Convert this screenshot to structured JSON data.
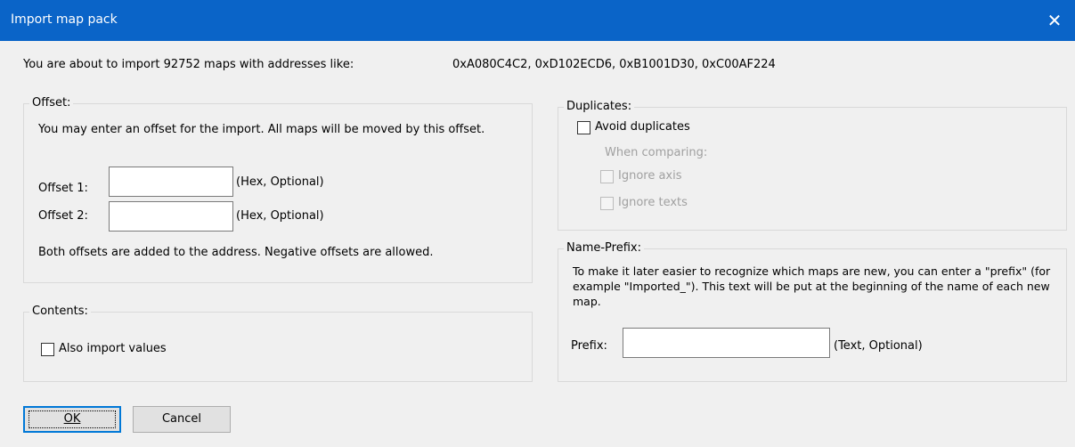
{
  "window": {
    "title": "Import map pack",
    "close_icon": "close-icon"
  },
  "intro": {
    "text": "You are about to import 92752 maps with addresses like:",
    "addresses": "0xA080C4C2, 0xD102ECD6, 0xB1001D30, 0xC00AF224"
  },
  "offset": {
    "legend": "Offset:",
    "description": "You may enter an offset for the import. All maps will be moved by this offset.",
    "offset1_label": "Offset 1:",
    "offset1_value": "",
    "offset1_hint": "(Hex, Optional)",
    "offset2_label": "Offset 2:",
    "offset2_value": "",
    "offset2_hint": "(Hex, Optional)",
    "note": "Both offsets are added to the address. Negative offsets are allowed."
  },
  "contents": {
    "legend": "Contents:",
    "also_import_values": "Also import values"
  },
  "duplicates": {
    "legend": "Duplicates:",
    "avoid": "Avoid duplicates",
    "when_comparing": "When comparing:",
    "ignore_axis": "Ignore axis",
    "ignore_texts": "Ignore texts"
  },
  "prefix": {
    "legend": "Name-Prefix:",
    "description": "To make it later easier to recognize which maps are new, you can enter a \"prefix\" (for example \"Imported_\"). This text will be put at the beginning of the name of each new map.",
    "label": "Prefix:",
    "value": "",
    "hint": "(Text, Optional)"
  },
  "buttons": {
    "ok": "OK",
    "cancel": "Cancel"
  }
}
